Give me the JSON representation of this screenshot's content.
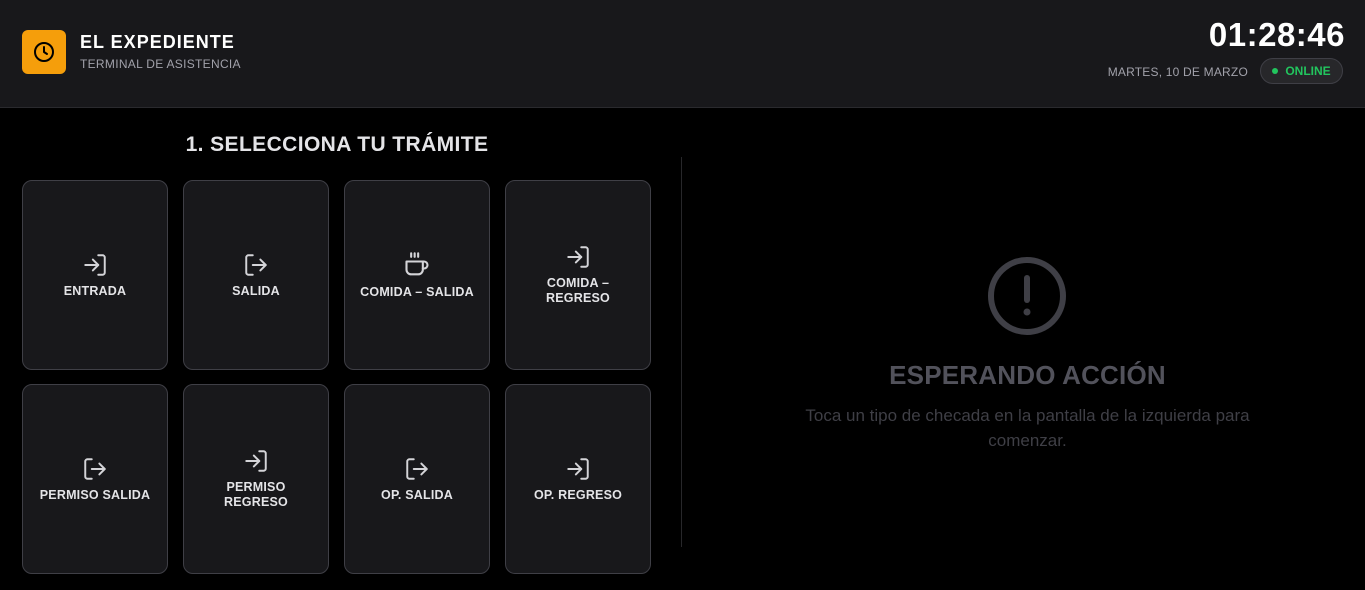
{
  "header": {
    "title": "EL EXPEDIENTE",
    "subtitle": "TERMINAL DE ASISTENCIA",
    "logo_icon": "clock-icon",
    "clock": "01:28:46",
    "date": "MARTES, 10 DE MARZO",
    "status": "ONLINE",
    "accent_color": "#f59e0b",
    "status_color": "#22c55e"
  },
  "main": {
    "section_title": "1. SELECCIONA TU TRÁMITE",
    "tiles": [
      {
        "label": "ENTRADA",
        "icon": "sign-in-icon"
      },
      {
        "label": "SALIDA",
        "icon": "sign-out-icon"
      },
      {
        "label": "COMIDA – SALIDA",
        "icon": "coffee-icon"
      },
      {
        "label": "COMIDA – REGRESO",
        "icon": "sign-in-icon"
      },
      {
        "label": "PERMISO SALIDA",
        "icon": "sign-out-icon"
      },
      {
        "label": "PERMISO REGRESO",
        "icon": "sign-in-icon"
      },
      {
        "label": "OP. SALIDA",
        "icon": "sign-out-icon"
      },
      {
        "label": "OP. REGRESO",
        "icon": "sign-in-icon"
      }
    ]
  },
  "status_panel": {
    "icon": "alert-circle-icon",
    "title": "ESPERANDO ACCIÓN",
    "message": "Toca un tipo de checada en la pantalla de la izquierda para comenzar."
  }
}
